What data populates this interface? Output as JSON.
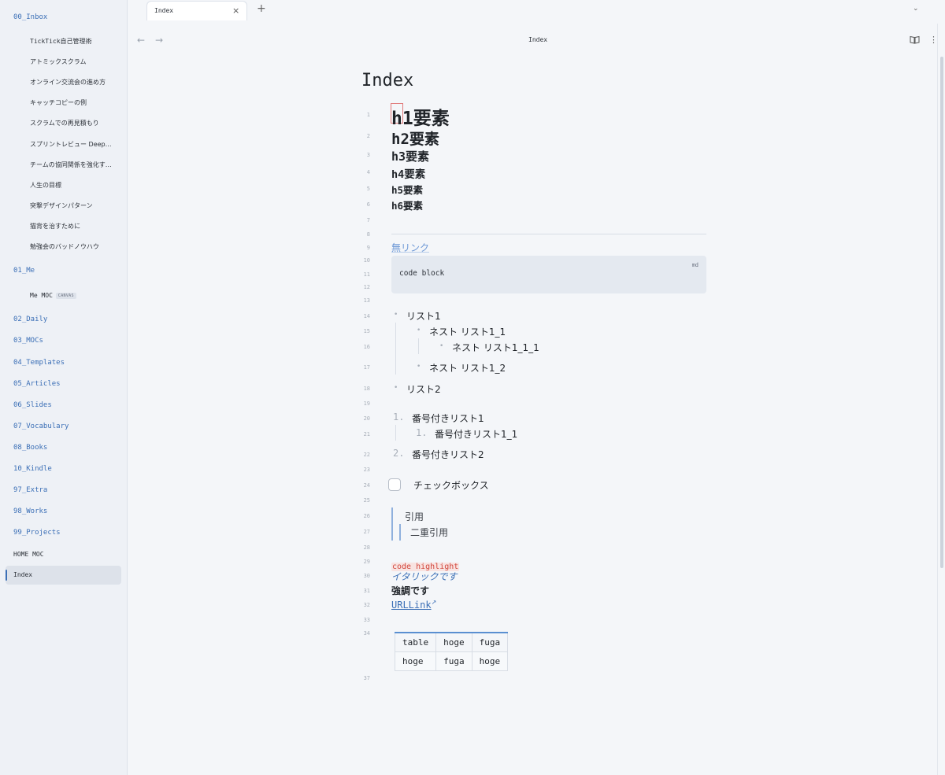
{
  "sidebar": {
    "folders": [
      {
        "label": "00_Inbox"
      },
      {
        "label": "01_Me"
      },
      {
        "label": "02_Daily"
      },
      {
        "label": "03_MOCs"
      },
      {
        "label": "04_Templates"
      },
      {
        "label": "05_Articles"
      },
      {
        "label": "06_Slides"
      },
      {
        "label": "07_Vocabulary"
      },
      {
        "label": "08_Books"
      },
      {
        "label": "10_Kindle"
      },
      {
        "label": "97_Extra"
      },
      {
        "label": "98_Works"
      },
      {
        "label": "99_Projects"
      }
    ],
    "inbox_files": [
      "TickTick自己管理術",
      "アトミックスクラム",
      "オンライン交流会の進め方",
      "キャッチコピーの例",
      "スクラムでの再見積もり",
      "スプリントレビュー Deep…",
      "チームの協同関係を強化す…",
      "人生の目標",
      "突撃デザインパターン",
      "猫背を治すために",
      "勉強会のバッドノウハウ"
    ],
    "me_file": "Me MOC",
    "me_badge": "CANVAS",
    "root_files": [
      "HOME MOC",
      "Index"
    ]
  },
  "tabbar": {
    "tab_label": "Index",
    "close_icon": "×",
    "add_icon": "+",
    "menu_icon": "⌄"
  },
  "header": {
    "back_icon": "←",
    "forward_icon": "→",
    "title": "Index",
    "more_icon": "⋮"
  },
  "doc": {
    "title": "Index",
    "line_numbers": [
      "1",
      "2",
      "3",
      "4",
      "5",
      "6",
      "7",
      "8",
      "9",
      "10",
      "11",
      "12",
      "13",
      "14",
      "15",
      "16",
      "17",
      "18",
      "19",
      "20",
      "21",
      "22",
      "23",
      "24",
      "25",
      "26",
      "27",
      "28",
      "29",
      "30",
      "31",
      "32",
      "33",
      "34",
      "37"
    ],
    "h1": "h1要素",
    "h2": "h2要素",
    "h3": "h3要素",
    "h4": "h4要素",
    "h5": "h5要素",
    "h6": "h6要素",
    "link_none": "無リンク",
    "code_block_text": "code block",
    "code_block_lang": "md",
    "list": {
      "item1": "リスト1",
      "nest1_1": "ネスト リスト1_1",
      "nest1_1_1": "ネスト リスト1_1_1",
      "nest1_2": "ネスト リスト1_2",
      "item2": "リスト2"
    },
    "ordered": {
      "num1": "1.",
      "item1": "番号付きリスト1",
      "num1_1": "1.",
      "item1_1": "番号付きリスト1_1",
      "num2": "2.",
      "item2": "番号付きリスト2"
    },
    "checkbox_label": "チェックボックス",
    "quote1": "引用",
    "quote2": "二重引用",
    "code_highlight": "code highlight",
    "italic": "イタリックです",
    "bold": "強調です",
    "urllink": "URLLink",
    "table": {
      "header": [
        "table",
        "hoge",
        "fuga"
      ],
      "rows": [
        [
          "hoge",
          "fuga",
          "hoge"
        ]
      ]
    }
  },
  "colors": {
    "accent": "#3b6fb6",
    "code_highlight": "#d1453b",
    "background": "#f4f6f9",
    "sidebar": "#eef1f6"
  }
}
